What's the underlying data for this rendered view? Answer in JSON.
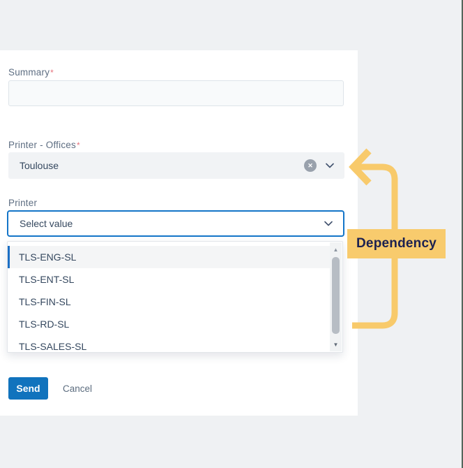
{
  "colors": {
    "background": "#eff1f3",
    "card": "#ffffff",
    "focus_border_blue": "#1475c8",
    "selected_option_bar_blue": "#1b6fc4",
    "send_button_blue": "#1173bd",
    "annotation_yellow": "#f8ca6b",
    "badge_background": "#f8cb6d",
    "badge_text": "#1c2150",
    "required_asterisk_red": "#e5737d",
    "right_edge_line": "#55665c"
  },
  "form": {
    "required_mark": "*",
    "summary": {
      "label": "Summary",
      "value": ""
    },
    "printer_offices": {
      "label": "Printer - Offices",
      "value": "Toulouse"
    },
    "printer": {
      "label": "Printer",
      "placeholder": "Select value"
    },
    "printer_options": [
      "TLS-ENG-SL",
      "TLS-ENT-SL",
      "TLS-FIN-SL",
      "TLS-RD-SL",
      "TLS-SALES-SL"
    ],
    "send_label": "Send",
    "cancel_label": "Cancel"
  },
  "annotation": {
    "badge_label": "Dependency",
    "arrow_color": "#f8ca6b"
  },
  "icons": {
    "clear_glyph": "✕",
    "scroll_up_glyph": "▲",
    "scroll_down_glyph": "▼"
  }
}
